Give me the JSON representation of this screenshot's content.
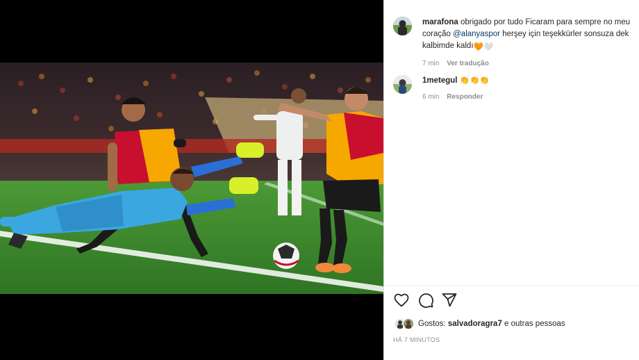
{
  "post": {
    "caption": {
      "username": "marafona",
      "text_before": "obrigado por tudo Ficaram para sempre no meu coração",
      "mention": "@alanyaspor",
      "text_after": "herşey için teşekkürler sonsuza dek kalbimde kaldı",
      "emoji_1": "🧡",
      "emoji_2": "🤍",
      "time": "7 min",
      "see_translation": "Ver tradução"
    },
    "comments": [
      {
        "username": "1metegul",
        "text": "👏👏👏",
        "time": "6 min",
        "reply": "Responder"
      }
    ],
    "likes": {
      "prefix": "Gostos:",
      "user": "salvadoragra7",
      "suffix": "e outras pessoas"
    },
    "posted_ago": "HÁ 7 MINUTOS"
  },
  "icons": {
    "like": "heart-outline-icon",
    "comment": "speech-bubble-icon",
    "share": "paper-plane-icon"
  },
  "colors": {
    "mention": "#00376b",
    "secondary_text": "#8e8e8e",
    "jersey_galatasaray_red": "#c8102e",
    "jersey_galatasaray_yellow": "#f6a800",
    "goalkeeper_blue": "#3ba7e0",
    "pitch_green": "#3f8a2e"
  }
}
